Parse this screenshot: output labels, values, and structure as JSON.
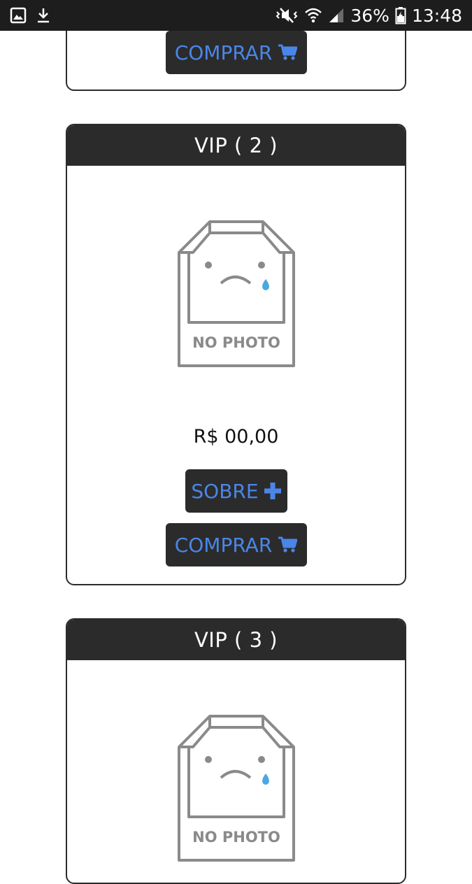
{
  "status_bar": {
    "battery": "36%",
    "time": "13:48",
    "icons": [
      "gallery-icon",
      "download-icon",
      "mute-vibrate-icon",
      "wifi-icon",
      "signal-icon",
      "battery-icon"
    ]
  },
  "cards": [
    {
      "buy_label": "COMPRAR"
    },
    {
      "title": "VIP ( 2 )",
      "image_text": "NO PHOTO",
      "price": "R$ 00,00",
      "about_label": "SOBRE",
      "buy_label": "COMPRAR"
    },
    {
      "title": "VIP ( 3 )",
      "image_text": "NO PHOTO"
    }
  ],
  "colors": {
    "accent": "#4a86e8",
    "dark": "#2b2b2b",
    "placeholder_gray": "#8a8a8a",
    "tear_blue": "#4aa8e0"
  }
}
